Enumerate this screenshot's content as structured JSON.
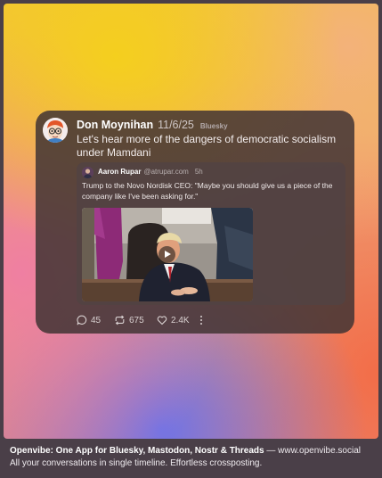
{
  "colors": {
    "card_bg": "#423434",
    "quote_bg": "#524343",
    "page_bg": "#4a3f48",
    "gradient_yellow": "#f4cf1e",
    "gradient_pink": "#ef7fa2",
    "gradient_blue": "#6f73e6",
    "gradient_orange": "#f26d48"
  },
  "post": {
    "avatar_icon": "cartoon-avatar-icon",
    "author": "Don Moynihan",
    "date": "11/6/25",
    "network": "Bluesky",
    "text": "Let's hear more of the dangers of democratic socialism under Mamdani",
    "quote": {
      "author": "Aaron Rupar",
      "handle": "@atrupar.com",
      "time": "5h",
      "text": "Trump to the Novo Nordisk CEO: \"Maybe you should give us a piece of the company like I've been asking for.\"",
      "media_icon": "play-icon"
    },
    "actions": {
      "replies": "45",
      "reposts": "675",
      "likes": "2.4K"
    }
  },
  "footer": {
    "headline": "Openvibe: One App for Bluesky, Mastodon, Nostr & Threads",
    "separator": " — ",
    "url": "www.openvibe.social",
    "tagline": "All your conversations in single timeline. Effortless crossposting."
  }
}
